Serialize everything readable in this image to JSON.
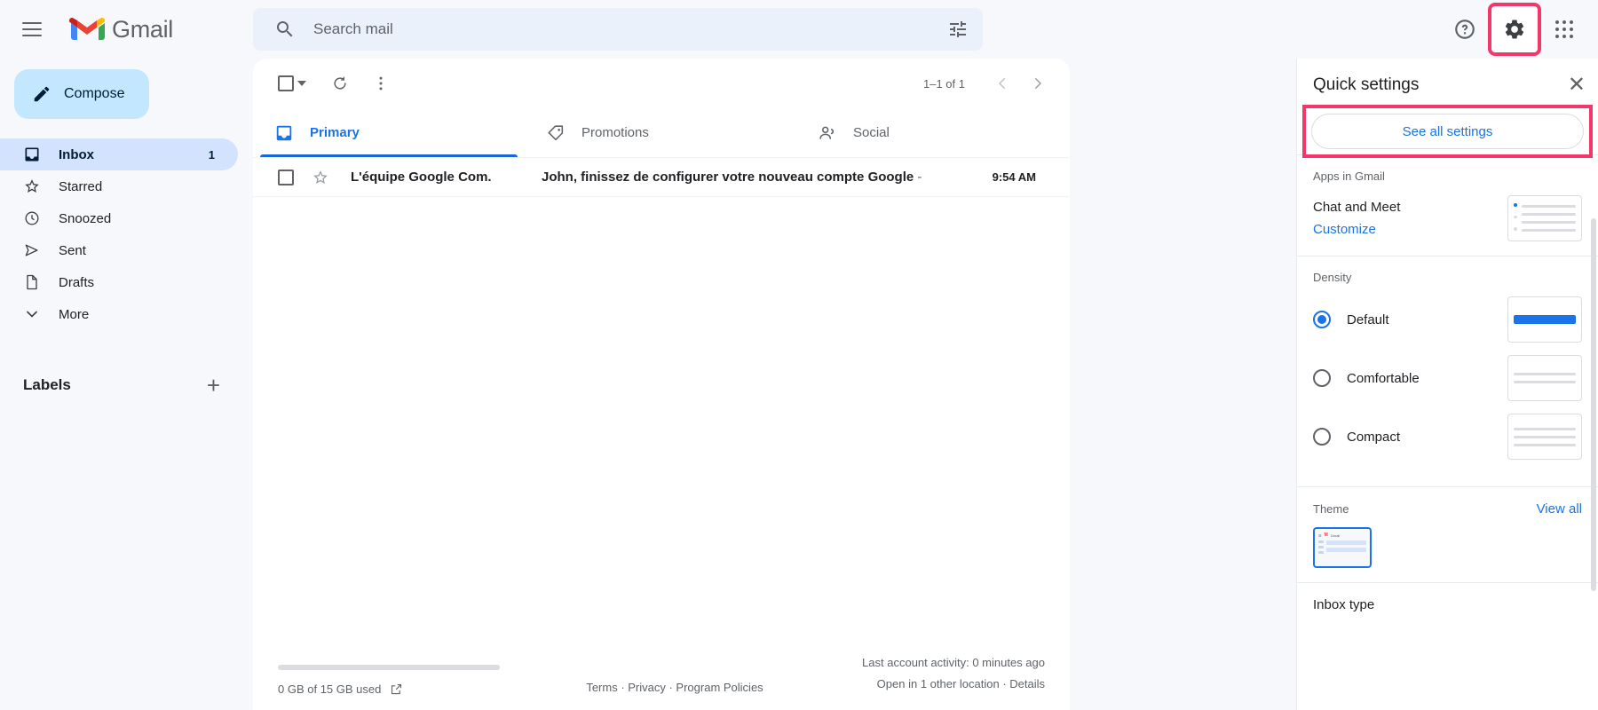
{
  "topbar": {
    "menu_icon": "hamburger-icon",
    "brand": "Gmail",
    "help_icon": "help-icon",
    "settings_icon": "gear-icon",
    "apps_icon": "apps-grid-icon"
  },
  "search": {
    "placeholder": "Search mail",
    "value": "",
    "search_icon": "search-icon",
    "options_icon": "tune-icon"
  },
  "sidebar": {
    "compose_label": "Compose",
    "items": [
      {
        "label": "Inbox",
        "count": "1",
        "icon": "inbox-icon",
        "active": true
      },
      {
        "label": "Starred",
        "count": "",
        "icon": "star-icon",
        "active": false
      },
      {
        "label": "Snoozed",
        "count": "",
        "icon": "clock-icon",
        "active": false
      },
      {
        "label": "Sent",
        "count": "",
        "icon": "send-icon",
        "active": false
      },
      {
        "label": "Drafts",
        "count": "",
        "icon": "draft-icon",
        "active": false
      },
      {
        "label": "More",
        "count": "",
        "icon": "chevron-down-icon",
        "active": false
      }
    ],
    "labels_title": "Labels",
    "add_label_icon": "plus-icon"
  },
  "maillist": {
    "select_all_icon": "checkbox-icon",
    "refresh_icon": "refresh-icon",
    "more_icon": "more-vertical-icon",
    "pagecount": "1–1 of 1",
    "prev_icon": "chevron-left-icon",
    "next_icon": "chevron-right-icon",
    "tabs": [
      {
        "label": "Primary",
        "icon": "inbox-tab-icon",
        "active": true
      },
      {
        "label": "Promotions",
        "icon": "tag-icon",
        "active": false
      },
      {
        "label": "Social",
        "icon": "people-icon",
        "active": false
      }
    ],
    "rows": [
      {
        "sender": "L'équipe Google Com.",
        "subject": "John, finissez de configurer votre nouveau compte Google",
        "snippet": "-",
        "time": "9:54 AM"
      }
    ]
  },
  "footer": {
    "storage_text": "0 GB of 15 GB used",
    "open_icon": "open-in-new-icon",
    "links": "Terms · Privacy · Program Policies",
    "activity_line1": "Last account activity: 0 minutes ago",
    "activity_line2": "Open in 1 other location · Details"
  },
  "quick_settings": {
    "title": "Quick settings",
    "close_icon": "close-icon",
    "see_all_label": "See all settings",
    "apps_section": {
      "title": "Apps in Gmail",
      "row_label": "Chat and Meet",
      "link": "Customize"
    },
    "density_section": {
      "title": "Density",
      "options": [
        {
          "label": "Default",
          "selected": true
        },
        {
          "label": "Comfortable",
          "selected": false
        },
        {
          "label": "Compact",
          "selected": false
        }
      ]
    },
    "theme_section": {
      "title": "Theme",
      "view_all": "View all",
      "thumb_brand": "Gmail"
    },
    "inbox_type_title": "Inbox type"
  },
  "colors": {
    "accent": "#1a73e8",
    "highlight": "#f2376a",
    "sidebar_bg": "#f6f8fc",
    "active_nav": "#d3e3fd",
    "compose_bg": "#c2e7ff"
  }
}
